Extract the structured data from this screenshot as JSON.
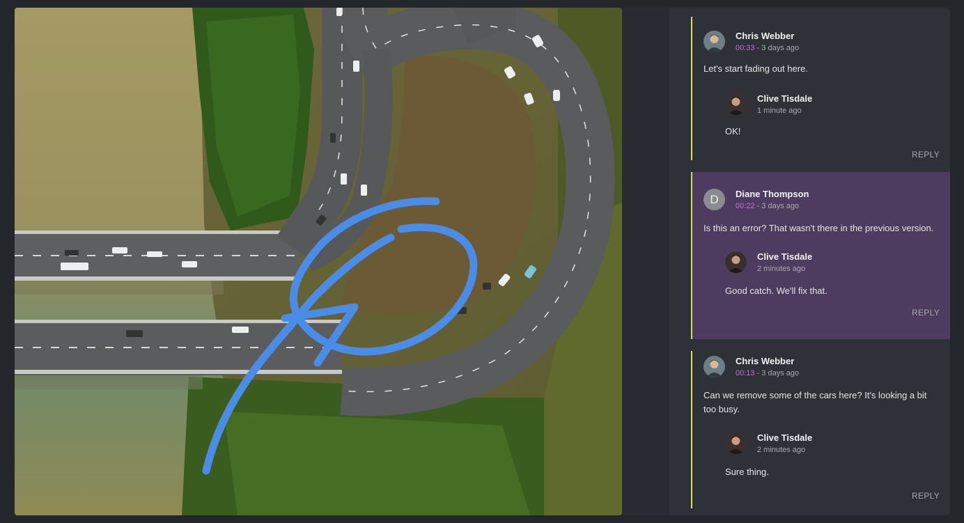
{
  "colors": {
    "thread_marker": "#d6e04a",
    "active_thread_bg": "#4d3c5f",
    "timecode": "#c26fd6",
    "annotation_stroke": "#4b8de6"
  },
  "viewer": {
    "image": "aerial-interchange-frame",
    "annotation": "blue-freehand-arrow"
  },
  "threads": [
    {
      "comment": {
        "author": "Chris Webber",
        "timecode": "00:33",
        "age": " - 3 days ago",
        "text": "Let's start fading out here.",
        "avatar": "chris-avatar"
      },
      "reply": {
        "author": "Clive Tisdale",
        "age": "1 minute ago",
        "text": "OK!",
        "avatar": "clive-avatar"
      },
      "reply_label": "REPLY"
    },
    {
      "comment": {
        "author": "Diane Thompson",
        "timecode": "00:22",
        "age": " - 3 days ago",
        "text": "Is this an error? That wasn't there in the previous version.",
        "avatar_letter": "D"
      },
      "reply": {
        "author": "Clive Tisdale",
        "age": "2 minutes ago",
        "text": "Good catch. We'll fix that.",
        "avatar": "clive-avatar"
      },
      "reply_label": "REPLY"
    },
    {
      "comment": {
        "author": "Chris Webber",
        "timecode": "00:13",
        "age": " - 3 days ago",
        "text": "Can we remove some of the cars here? It's looking a bit too busy.",
        "avatar": "chris-avatar"
      },
      "reply": {
        "author": "Clive Tisdale",
        "age": "2 minutes ago",
        "text": "Sure thing.",
        "avatar": "clive-avatar"
      },
      "reply_label": "REPLY"
    }
  ]
}
